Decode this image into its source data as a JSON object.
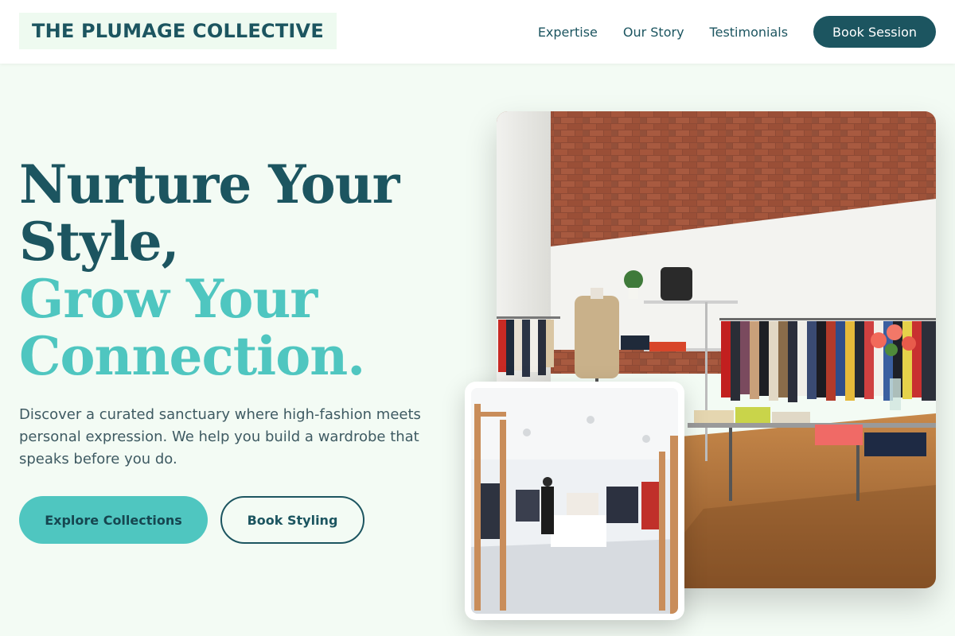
{
  "header": {
    "brand": "THE PLUMAGE COLLECTIVE",
    "nav": [
      "Expertise",
      "Our Story",
      "Testimonials"
    ],
    "cta": "Book Session"
  },
  "hero": {
    "headline_line1": "Nurture Your",
    "headline_line2": "Style,",
    "headline_line3": "Grow Your",
    "headline_line4": "Connection.",
    "subtext": "Discover a curated sanctuary where high-fashion meets personal expression. We help you build a wardrobe that speaks before you do.",
    "primary_button": "Explore Collections",
    "secondary_button": "Book Styling"
  },
  "colors": {
    "primary": "#1c5560",
    "accent": "#4fc6c0",
    "background": "#f3fbf4"
  }
}
